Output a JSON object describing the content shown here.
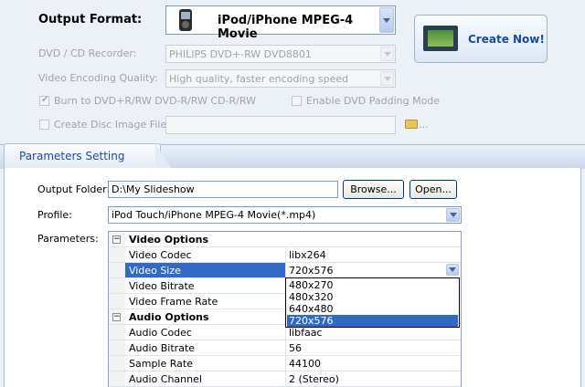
{
  "output_format": {
    "label": "Output Format:",
    "value": "iPod/iPhone MPEG-4 Movie",
    "icon": "ipod-icon"
  },
  "create_button": {
    "label": "Create Now!",
    "icon": "film-icon"
  },
  "dvd_recorder": {
    "label": "DVD / CD Recorder:",
    "value": "PHILIPS DVD+-RW DVD8801"
  },
  "encoding_quality": {
    "label": "Video Encoding Quality:",
    "value": "High quality, faster encoding speed"
  },
  "burn_checkbox": {
    "label": "Burn to DVD+R/RW DVD-R/RW  CD-R/RW",
    "checked": true
  },
  "padding_checkbox": {
    "label": "Enable DVD Padding Mode",
    "checked": false
  },
  "disc_image": {
    "label": "Create Disc Image File:",
    "value": "",
    "browse_icon": "folder-icon",
    "browse_text": "..."
  },
  "tab": {
    "label": "Parameters Setting"
  },
  "output_folder": {
    "label": "Output Folder:",
    "value": "D:\\My Slideshow",
    "browse": "Browse...",
    "open": "Open..."
  },
  "profile": {
    "label": "Profile:",
    "value": "iPod Touch/iPhone MPEG-4 Movie(*.mp4)"
  },
  "parameters": {
    "label": "Parameters:",
    "video_options": "Video Options",
    "audio_options": "Audio Options",
    "rows": {
      "video_codec": {
        "name": "Video Codec",
        "value": "libx264"
      },
      "video_size": {
        "name": "Video Size",
        "value": "720x576"
      },
      "video_bitrate": {
        "name": "Video Bitrate",
        "value": ""
      },
      "video_frame_rate": {
        "name": "Video Frame Rate",
        "value": ""
      },
      "audio_codec": {
        "name": "Audio Codec",
        "value": "libfaac"
      },
      "audio_bitrate": {
        "name": "Audio Bitrate",
        "value": "56"
      },
      "sample_rate": {
        "name": "Sample Rate",
        "value": "44100"
      },
      "audio_channel": {
        "name": "Audio Channel",
        "value": "2 (Stereo)"
      }
    },
    "expand_symbol": "⊟"
  },
  "video_size_options": [
    "480x270",
    "480x320",
    "640x480",
    "720x576"
  ],
  "colors": {
    "selection": "#316ac5",
    "accent_text": "#1a4c9c"
  }
}
